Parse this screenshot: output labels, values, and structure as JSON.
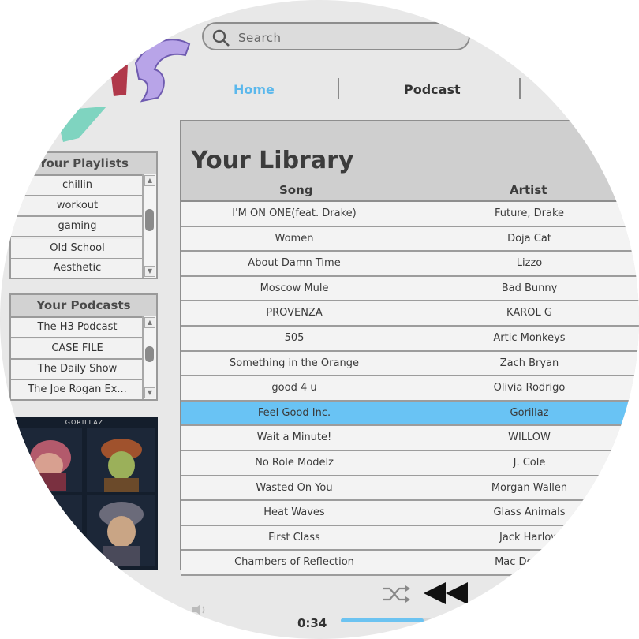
{
  "search": {
    "placeholder": "Search"
  },
  "nav": {
    "tabs": [
      {
        "label": "Home",
        "active": true
      },
      {
        "label": "Podcast",
        "active": false
      }
    ]
  },
  "playlists": {
    "title": "Your Playlists",
    "items": [
      "chillin",
      "workout",
      "gaming",
      "Old School",
      "Aesthetic"
    ]
  },
  "podcasts": {
    "title": "Your Podcasts",
    "items": [
      "The H3 Podcast",
      "CASE FILE",
      "The Daily Show",
      "The Joe Rogan Ex..."
    ]
  },
  "album": {
    "brand": "GORILLAZ"
  },
  "library": {
    "title": "Your Library",
    "columns": [
      "Song",
      "Artist"
    ],
    "rows": [
      {
        "song": "I'M ON ONE(feat. Drake)",
        "artist": "Future, Drake"
      },
      {
        "song": "Women",
        "artist": "Doja Cat"
      },
      {
        "song": "About Damn Time",
        "artist": "Lizzo"
      },
      {
        "song": "Moscow Mule",
        "artist": "Bad Bunny"
      },
      {
        "song": "PROVENZA",
        "artist": "KAROL G"
      },
      {
        "song": "505",
        "artist": "Artic Monkeys"
      },
      {
        "song": "Something in the Orange",
        "artist": "Zach Bryan"
      },
      {
        "song": "good 4 u",
        "artist": "Olivia Rodrigo"
      },
      {
        "song": "Feel Good Inc.",
        "artist": "Gorillaz",
        "selected": true
      },
      {
        "song": "Wait a Minute!",
        "artist": "WILLOW"
      },
      {
        "song": "No Role Modelz",
        "artist": "J. Cole"
      },
      {
        "song": "Wasted On You",
        "artist": "Morgan Wallen"
      },
      {
        "song": "Heat Waves",
        "artist": "Glass Animals"
      },
      {
        "song": "First Class",
        "artist": "Jack Harlow"
      },
      {
        "song": "Chambers of Reflection",
        "artist": "Mac DeMarco"
      }
    ]
  },
  "player": {
    "time": "0:34",
    "progress": 0.35
  },
  "colors": {
    "accent": "#69c3f4",
    "nav_active": "#5bb8ec",
    "panel_header": "#d2d2d2"
  },
  "icons": {
    "search": "search-icon",
    "shuffle": "shuffle-icon",
    "rewind": "rewind-icon",
    "volume": "volume-icon"
  }
}
